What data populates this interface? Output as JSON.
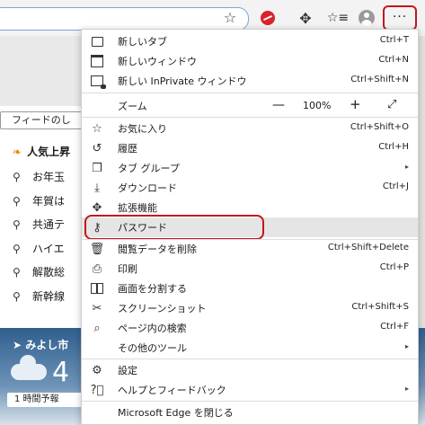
{
  "background": {
    "feedback_label": "フィードのし",
    "trending_title": "人気上昇",
    "search_items": [
      "お年玉",
      "年賀は",
      "共通テ",
      "ハイエ",
      "解散総",
      "新幹線"
    ],
    "weather_location": "みよし市",
    "weather_temp": "4",
    "forecast_label": "1 時間予報"
  },
  "toolbar": {
    "star_icon": "star-outline-icon",
    "extension_icons": [
      "red-shield-icon",
      "puzzle-icon",
      "favorites-icon",
      "profile-icon"
    ],
    "more_label": "···"
  },
  "menu": {
    "items": [
      {
        "label": "新しいタブ",
        "shortcut": "Ctrl+T",
        "icon": "new-tab-icon"
      },
      {
        "label": "新しいウィンドウ",
        "shortcut": "Ctrl+N",
        "icon": "new-window-icon"
      },
      {
        "label": "新しい InPrivate ウィンドウ",
        "shortcut": "Ctrl+Shift+N",
        "icon": "inprivate-icon"
      },
      {
        "label": "お気に入り",
        "shortcut": "Ctrl+Shift+O",
        "icon": "favorites-icon"
      },
      {
        "label": "履歴",
        "shortcut": "Ctrl+H",
        "icon": "history-icon"
      },
      {
        "label": "タブ グループ",
        "shortcut": "",
        "icon": "tab-group-icon"
      },
      {
        "label": "ダウンロード",
        "shortcut": "Ctrl+J",
        "icon": "download-icon"
      },
      {
        "label": "拡張機能",
        "shortcut": "",
        "icon": "extensions-icon"
      },
      {
        "label": "パスワード",
        "shortcut": "",
        "icon": "key-icon"
      },
      {
        "label": "閲覧データを削除",
        "shortcut": "Ctrl+Shift+Delete",
        "icon": "trash-icon"
      },
      {
        "label": "印刷",
        "shortcut": "Ctrl+P",
        "icon": "print-icon"
      },
      {
        "label": "画面を分割する",
        "shortcut": "",
        "icon": "split-screen-icon"
      },
      {
        "label": "スクリーンショット",
        "shortcut": "Ctrl+Shift+S",
        "icon": "screenshot-icon"
      },
      {
        "label": "ページ内の検索",
        "shortcut": "Ctrl+F",
        "icon": "find-icon"
      },
      {
        "label": "その他のツール",
        "shortcut": "",
        "icon": ""
      },
      {
        "label": "設定",
        "shortcut": "",
        "icon": "settings-icon"
      },
      {
        "label": "ヘルプとフィードバック",
        "shortcut": "",
        "icon": "help-icon"
      },
      {
        "label": "Microsoft Edge を閉じる",
        "shortcut": "",
        "icon": ""
      }
    ],
    "zoom": {
      "label": "ズーム",
      "minus": "—",
      "value": "100%",
      "plus": "+",
      "fullscreen": "⤢"
    },
    "submenu_arrow": "▸",
    "highlighted_item": "パスワード"
  },
  "colors": {
    "highlight_outline": "#c4161c",
    "hover_bg": "#e5e5e5"
  }
}
